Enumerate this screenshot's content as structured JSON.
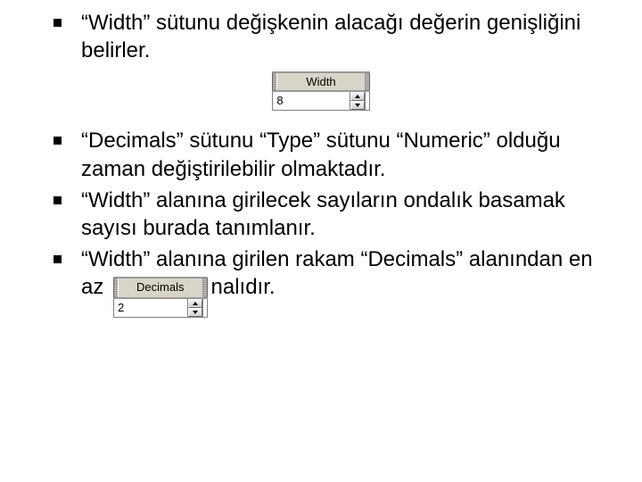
{
  "bullets": {
    "b1": "“Width” sütunu değişkenin alacağı değerin genişliğini belirler.",
    "b2": "“Decimals” sütunu “Type” sütunu “Numeric” olduğu zaman değiştirilebilir olmaktadır.",
    "b3": "“Width” alanına girilecek sayıların ondalık basamak sayısı burada tanımlanır.",
    "b4_a": "“Width” alanına girilen rakam “Decimals” alanından en az",
    "b4_b": "nalıdır."
  },
  "widget_width": {
    "header": "Width",
    "value": "8"
  },
  "widget_decimals": {
    "header": "Decimals",
    "value": "2"
  }
}
